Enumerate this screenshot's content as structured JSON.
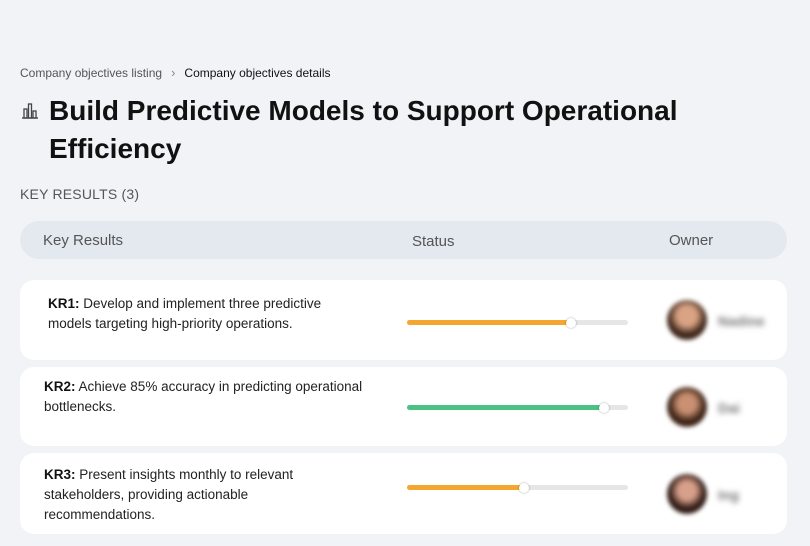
{
  "breadcrumb": {
    "parent": "Company objectives listing",
    "separator": "›",
    "current": "Company objectives details"
  },
  "objective": {
    "icon": "building-chart-icon",
    "title": "Build Predictive Models to Support Operational Efficiency"
  },
  "key_results_section": {
    "label": "KEY RESULTS (3)"
  },
  "table": {
    "columns": [
      "Key Results",
      "Status",
      "Owner"
    ],
    "rows": [
      {
        "id": "KR1:",
        "text": " Develop and implement three predictive models targeting high-priority operations.",
        "progress": 0.74,
        "color": "#f5a630",
        "owner": "Nadine"
      },
      {
        "id": "KR2:",
        "text": " Achieve 85% accuracy in predicting operational bottlenecks.",
        "progress": 0.89,
        "color": "#4cc184",
        "owner": "Dai"
      },
      {
        "id": "KR3:",
        "text": " Present insights monthly to relevant stakeholders, providing actionable recommendations.",
        "progress": 0.53,
        "color": "#f5a630",
        "owner": "Ing"
      }
    ]
  }
}
